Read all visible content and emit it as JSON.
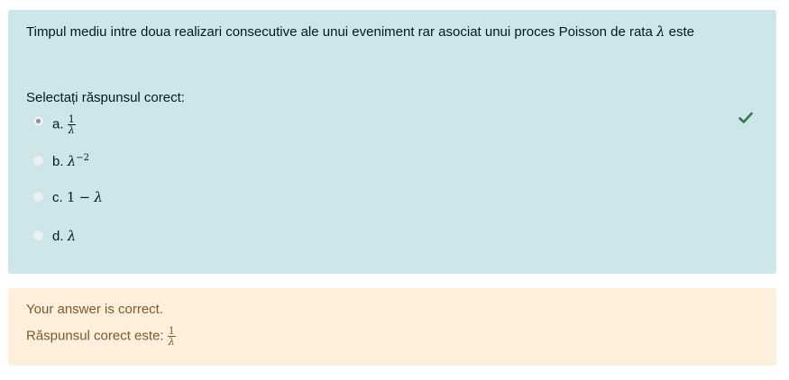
{
  "question": {
    "text_before": "Timpul mediu intre doua realizari consecutive ale unui eveniment rar asociat unui proces Poisson de rata ",
    "lambda": "λ",
    "text_after": " este",
    "prompt": "Selectați răspunsul corect:",
    "options": [
      {
        "letter": "a.",
        "numerator": "1",
        "denominator": "λ",
        "selected": true,
        "icon": "radio-checked"
      },
      {
        "letter": "b.",
        "base": "λ",
        "exponent": "−2",
        "selected": false,
        "icon": "radio"
      },
      {
        "letter": "c.",
        "expr_left": "1",
        "operator": "−",
        "expr_right": "λ",
        "selected": false,
        "icon": "radio"
      },
      {
        "letter": "d.",
        "expr": "λ",
        "selected": false,
        "icon": "radio"
      }
    ],
    "correct_icon": "check-icon",
    "correct_color": "#2c7f3c",
    "background": "#cce6ea"
  },
  "feedback": {
    "result": "Your answer is correct.",
    "answer_label": "Răspunsul corect este: ",
    "answer_numerator": "1",
    "answer_denominator": "λ",
    "background": "#fcefdc"
  }
}
